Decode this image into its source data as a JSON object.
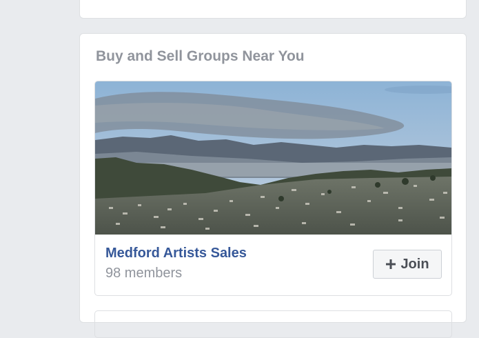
{
  "section": {
    "title": "Buy and Sell Groups Near You"
  },
  "group": {
    "name": "Medford Artists Sales",
    "members": "98 members",
    "join_label": "Join",
    "join_icon": "plus-icon",
    "photo_icon": "landscape-photo"
  },
  "colors": {
    "page_bg": "#e9ebee",
    "title_gray": "#90949c",
    "link_blue": "#365899",
    "button_bg": "#f5f6f7",
    "button_text": "#4b4f56"
  }
}
